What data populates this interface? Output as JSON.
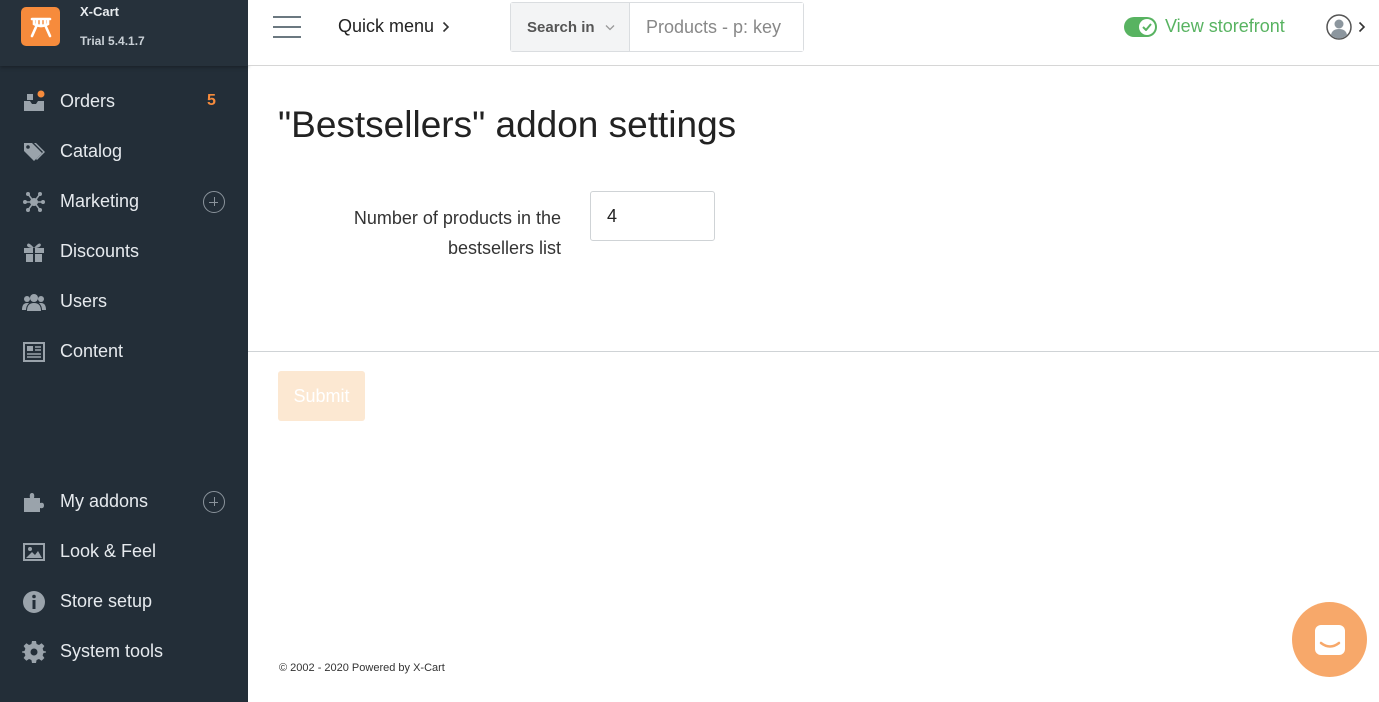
{
  "brand": {
    "name": "X-Cart",
    "version": "Trial 5.4.1.7"
  },
  "sidebar": {
    "items": [
      {
        "label": "Orders",
        "count": "5",
        "icon": "orders-icon"
      },
      {
        "label": "Catalog",
        "icon": "tags-icon"
      },
      {
        "label": "Marketing",
        "icon": "network-icon"
      },
      {
        "label": "Discounts",
        "icon": "gift-icon"
      },
      {
        "label": "Users",
        "icon": "users-icon"
      },
      {
        "label": "Content",
        "icon": "newspaper-icon"
      },
      {
        "label": "My addons",
        "icon": "puzzle-icon"
      },
      {
        "label": "Look & Feel",
        "icon": "image-icon"
      },
      {
        "label": "Store setup",
        "icon": "info-icon"
      },
      {
        "label": "System tools",
        "icon": "gear-icon"
      }
    ]
  },
  "header": {
    "quick_menu": "Quick menu",
    "search_in": "Search in",
    "search_placeholder": "Products - p: key",
    "view_storefront": "View storefront"
  },
  "main": {
    "title": "\"Bestsellers\" addon settings",
    "field_label": "Number of products in the bestsellers list",
    "field_value": "4",
    "submit_label": "Submit"
  },
  "footer": {
    "text": "© 2002 - 2020 Powered by X-Cart"
  },
  "colors": {
    "accent": "#f68b3c",
    "sidebar": "#232e38",
    "storefront_green": "#58b361"
  }
}
